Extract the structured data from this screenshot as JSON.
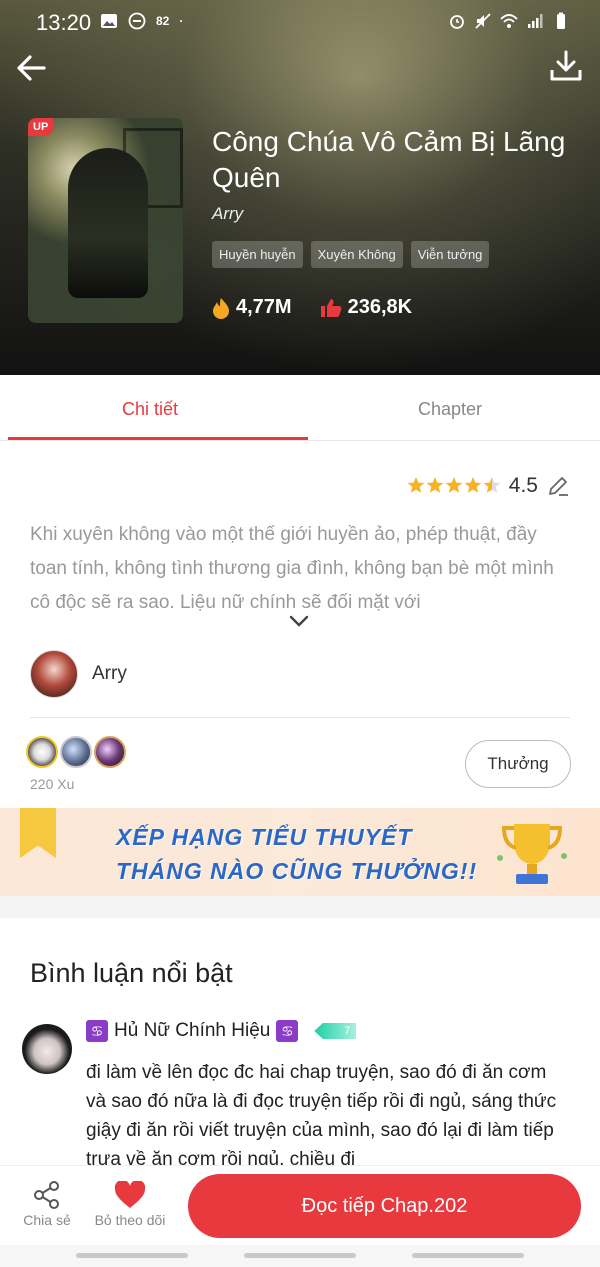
{
  "status_bar": {
    "time": "13:20",
    "notification_count": "82"
  },
  "book": {
    "badge": "UP",
    "title": "Công Chúa Vô Cảm Bị Lãng Quên",
    "author": "Arry",
    "tags": [
      "Huyền huyễn",
      "Xuyên Không",
      "Viễn tưởng"
    ],
    "views": "4,77M",
    "likes": "236,8K"
  },
  "tabs": [
    {
      "label": "Chi tiết",
      "active": true
    },
    {
      "label": "Chapter",
      "active": false
    }
  ],
  "rating": {
    "value": "4.5",
    "stars_filled": 4.5
  },
  "description": "Khi xuyên không vào một thế giới huyền ảo, phép thuật, đầy toan tính, không tình thương gia đình, không bạn bè một mình cô độc sẽ ra sao. Liệu nữ chính sẽ đối mặt với",
  "author_row": {
    "name": "Arry"
  },
  "donations": {
    "coins_text": "220 Xu",
    "reward_button": "Thưởng"
  },
  "banner": {
    "line1": "XẾP HẠNG TIỂU THUYẾT",
    "line2": "THÁNG NÀO CŨNG THƯỞNG!!"
  },
  "comments": {
    "section_title": "Bình luận nổi bật",
    "items": [
      {
        "user": "Hủ Nữ Chính Hiệu",
        "zodiac_symbol": "♋",
        "level": "7",
        "text": "đi làm về lên đọc đc hai chap truyện, sao đó đi ăn cơm và sao đó nữa là đi đọc truyện tiếp rồi đi ngủ, sáng thức giậy đi ăn rồi viết truyện của mình, sao đó lại đi làm tiếp trưa về ăn cơm rồi ngủ, chiều đi"
      }
    ]
  },
  "bottom_bar": {
    "share_label": "Chia sẻ",
    "unfollow_label": "Bỏ theo dõi",
    "read_button": "Đọc tiếp Chap.202"
  },
  "colors": {
    "accent": "#e8393f",
    "banner_text": "#2b67c8"
  }
}
